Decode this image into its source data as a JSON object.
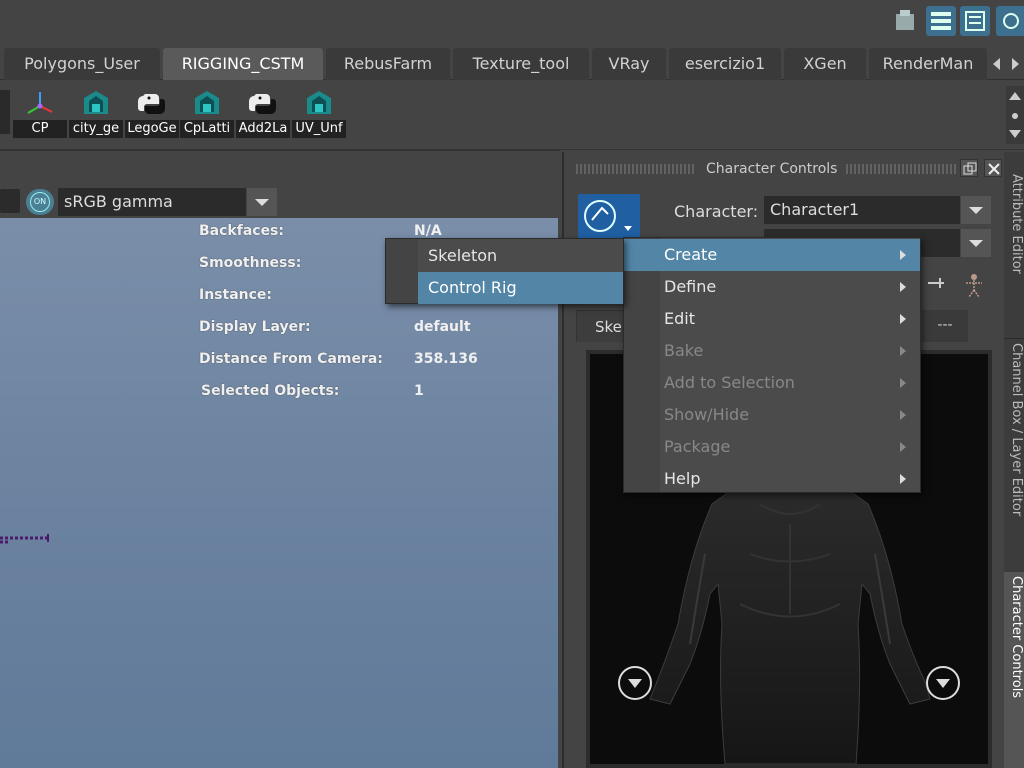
{
  "shelf_tabs": [
    "Polygons_User",
    "RIGGING_CSTM",
    "RebusFarm",
    "Texture_tool",
    "VRay",
    "esercizio1",
    "XGen",
    "RenderMan"
  ],
  "shelf_tab_active": "RIGGING_CSTM",
  "shelf_buttons": [
    {
      "label": "CP",
      "icon": "axis-icon"
    },
    {
      "label": "city_ge",
      "icon": "mel-tower-icon"
    },
    {
      "label": "LegoGe",
      "icon": "python-icon"
    },
    {
      "label": "CpLatti",
      "icon": "mel-tower-icon"
    },
    {
      "label": "Add2La",
      "icon": "python-icon"
    },
    {
      "label": "UV_Unf",
      "icon": "mel-tower-icon"
    }
  ],
  "viewport": {
    "color_space": "sRGB gamma",
    "on_badge": "ON",
    "hud": [
      {
        "label": "Backfaces:",
        "value": "N/A"
      },
      {
        "label": "Smoothness:",
        "value": ""
      },
      {
        "label": "Instance:",
        "value": ""
      },
      {
        "label": "Display Layer:",
        "value": "default"
      },
      {
        "label": "Distance From Camera:",
        "value": "358.136"
      },
      {
        "label": "Selected Objects:",
        "value": "1"
      }
    ]
  },
  "panel": {
    "title": "Character Controls",
    "character_label": "Character:",
    "character_value": "Character1",
    "tab_partial": "Ske",
    "tab_dashes": "---"
  },
  "side_tabs": [
    "Attribute Editor",
    "Channel Box / Layer Editor",
    "Character Controls"
  ],
  "context_menu": {
    "items": [
      {
        "label": "Create",
        "enabled": true,
        "highlighted": true
      },
      {
        "label": "Define",
        "enabled": true
      },
      {
        "label": "Edit",
        "enabled": true
      },
      {
        "label": "Bake",
        "enabled": false
      },
      {
        "label": "Add to Selection",
        "enabled": false
      },
      {
        "label": "Show/Hide",
        "enabled": false
      },
      {
        "label": "Package",
        "enabled": false
      },
      {
        "label": "Help",
        "enabled": true
      }
    ]
  },
  "submenu": {
    "items": [
      {
        "label": "Skeleton",
        "highlighted": false
      },
      {
        "label": "Control Rig",
        "highlighted": true
      }
    ]
  },
  "colors": {
    "menu_highlight": "#5285a6",
    "viewport_top": "#7a8ea9",
    "active_tab": "#5a5a5a"
  }
}
